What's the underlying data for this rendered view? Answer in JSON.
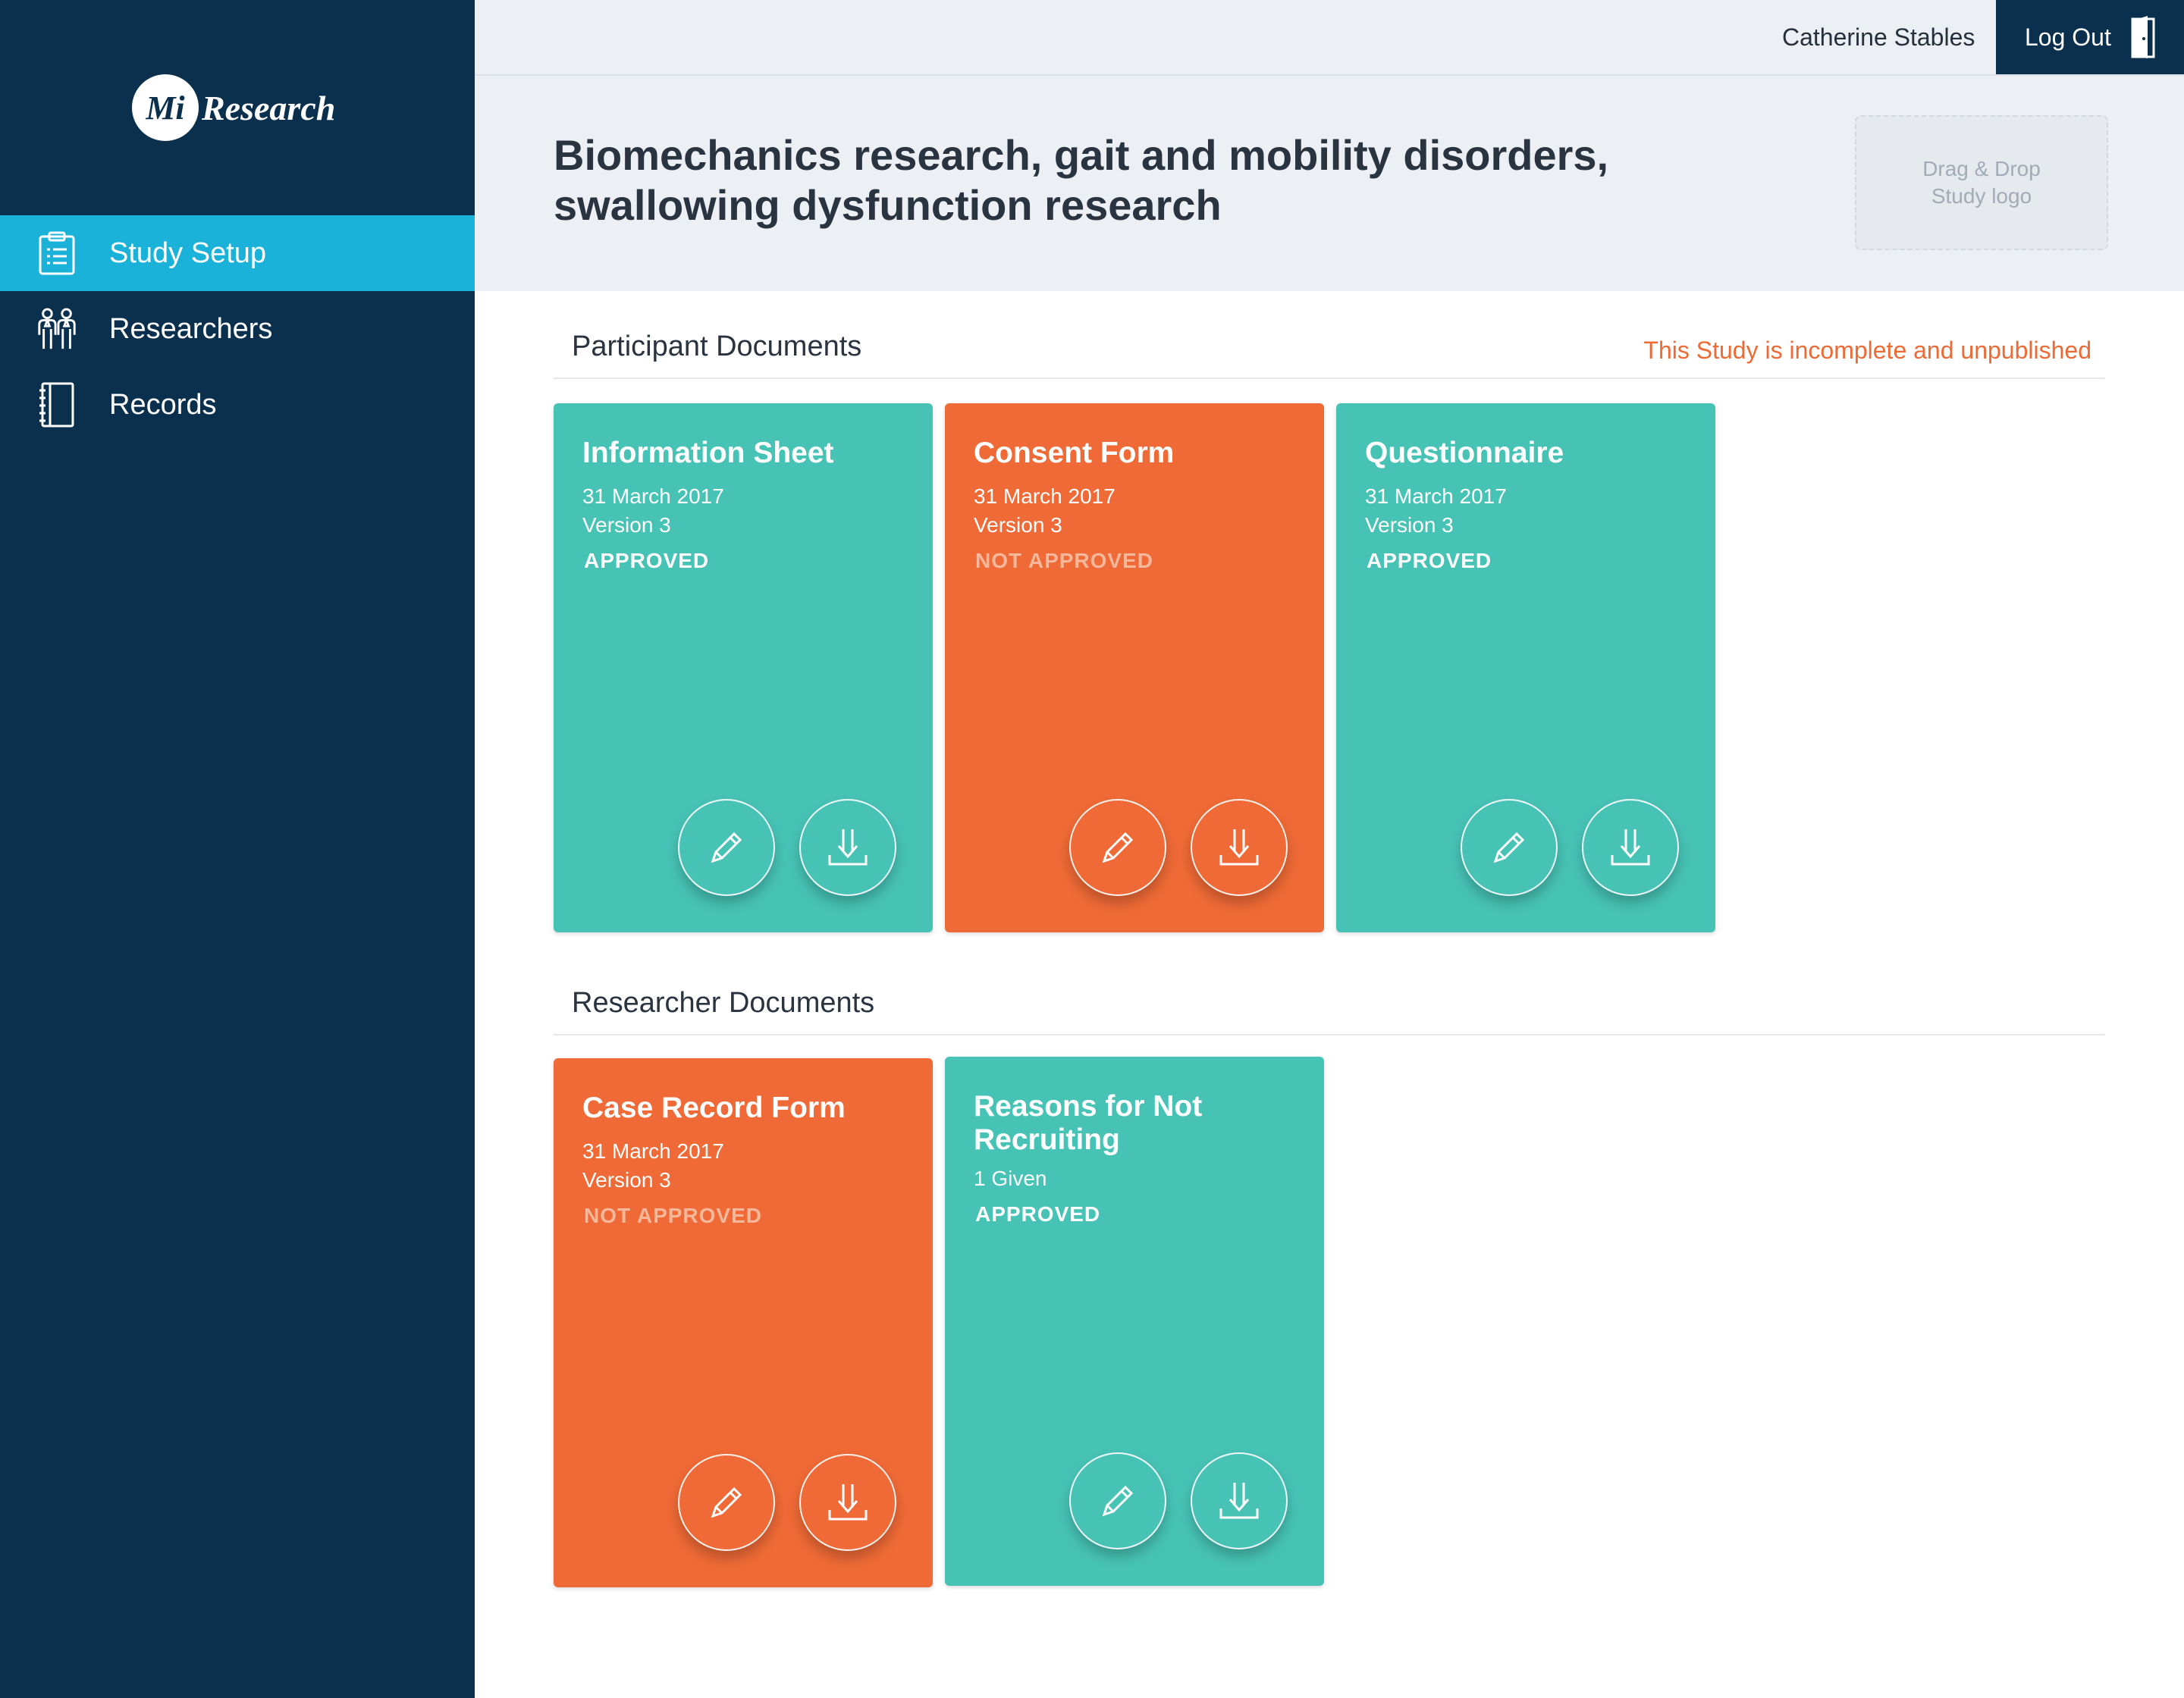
{
  "app": {
    "logo_mark": "Mi",
    "logo_text": "Research"
  },
  "sidebar": {
    "items": [
      {
        "label": "Study Setup",
        "icon": "clipboard-icon",
        "active": true
      },
      {
        "label": "Researchers",
        "icon": "researchers-icon",
        "active": false
      },
      {
        "label": "Records",
        "icon": "notebook-icon",
        "active": false
      }
    ]
  },
  "topbar": {
    "user_name": "Catherine Stables",
    "logout_label": "Log Out"
  },
  "header": {
    "study_title_line1": "Biomechanics research, gait and mobility disorders,",
    "study_title_line2": "swallowing dysfunction research",
    "logo_drop_line1": "Drag & Drop",
    "logo_drop_line2": "Study logo"
  },
  "participant_documents": {
    "title": "Participant Documents",
    "warning": "This Study is incomplete and unpublished",
    "cards": [
      {
        "title": "Information Sheet",
        "date": "31 March 2017",
        "version": "Version 3",
        "status": "APPROVED",
        "color": "#47c3b6"
      },
      {
        "title": "Consent Form",
        "date": "31 March 2017",
        "version": "Version 3",
        "status": "NOT APPROVED",
        "color": "#ef6a36"
      },
      {
        "title": "Questionnaire",
        "date": "31 March 2017",
        "version": "Version 3",
        "status": "APPROVED",
        "color": "#47c3b6"
      }
    ]
  },
  "researcher_documents": {
    "title": "Researcher Documents",
    "cards": [
      {
        "title": "Case Record Form",
        "date": "31 March 2017",
        "version": "Version 3",
        "status": "NOT APPROVED",
        "color": "#ef6a36"
      },
      {
        "title_line1": "Reasons for Not",
        "title_line2": "Recruiting",
        "detail": "1 Given",
        "status": "APPROVED",
        "color": "#47c3b6"
      }
    ]
  },
  "colors": {
    "sidebar_bg": "#0b304d",
    "active_nav": "#1ab2d9",
    "approved_card": "#47c3b6",
    "not_approved_card": "#ef6a36",
    "warning_text": "#ee6a35"
  }
}
